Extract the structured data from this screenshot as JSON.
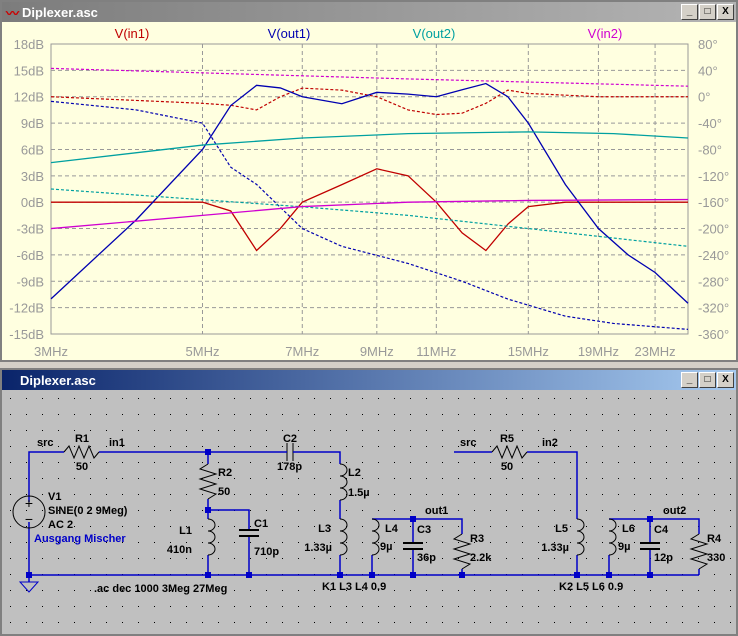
{
  "plot_window": {
    "title": "Diplexer.asc",
    "buttons": [
      "_",
      "□",
      "X"
    ]
  },
  "schematic_window": {
    "title": "Diplexer.asc",
    "buttons": [
      "_",
      "□",
      "X"
    ]
  },
  "chart_data": {
    "type": "line",
    "title": "",
    "xscale": "log",
    "xlim": [
      3,
      25.7
    ],
    "x_ticks": [
      "3MHz",
      "5MHz",
      "7MHz",
      "9MHz",
      "11MHz",
      "15MHz",
      "19MHz",
      "23MHz"
    ],
    "x_tick_values": [
      3,
      5,
      7,
      9,
      11,
      15,
      19,
      23
    ],
    "y_ticks": [
      "18dB",
      "15dB",
      "12dB",
      "9dB",
      "6dB",
      "3dB",
      "0dB",
      "-3dB",
      "-6dB",
      "-9dB",
      "-12dB",
      "-15dB"
    ],
    "ylim": [
      -15,
      18
    ],
    "y2_ticks": [
      "80°",
      "40°",
      "0°",
      "-40°",
      "-80°",
      "-120°",
      "-160°",
      "-200°",
      "-240°",
      "-280°",
      "-320°",
      "-360°"
    ],
    "y2lim": [
      -360,
      80
    ],
    "grid": true,
    "series": [
      {
        "name": "V(in1)",
        "color": "#c00000",
        "mag": [
          [
            3,
            0
          ],
          [
            5,
            0
          ],
          [
            5.5,
            -1
          ],
          [
            6,
            -5.5
          ],
          [
            6.5,
            -3
          ],
          [
            7,
            0
          ],
          [
            8,
            2
          ],
          [
            9,
            3.8
          ],
          [
            10,
            3
          ],
          [
            11,
            0
          ],
          [
            12,
            -3.5
          ],
          [
            13,
            -5.5
          ],
          [
            14,
            -2.5
          ],
          [
            15,
            -0.5
          ],
          [
            17,
            0
          ],
          [
            25.7,
            0
          ]
        ],
        "phase": [
          [
            3,
            0
          ],
          [
            5,
            -10
          ],
          [
            5.5,
            -13
          ],
          [
            6,
            -20
          ],
          [
            6.5,
            0
          ],
          [
            7,
            13
          ],
          [
            8,
            10
          ],
          [
            9,
            0
          ],
          [
            10,
            -20
          ],
          [
            11,
            -27
          ],
          [
            12,
            -25
          ],
          [
            13,
            -10
          ],
          [
            14,
            10
          ],
          [
            15,
            5
          ],
          [
            19,
            0
          ],
          [
            25.7,
            0
          ]
        ]
      },
      {
        "name": "V(out1)",
        "color": "#0000b0",
        "mag": [
          [
            3,
            -11
          ],
          [
            4,
            -2
          ],
          [
            5,
            6
          ],
          [
            5.5,
            11
          ],
          [
            6,
            13.3
          ],
          [
            6.5,
            13
          ],
          [
            7,
            12
          ],
          [
            8,
            11.2
          ],
          [
            9,
            12.5
          ],
          [
            10,
            12.3
          ],
          [
            11,
            12
          ],
          [
            12,
            12.8
          ],
          [
            13,
            13.5
          ],
          [
            14,
            12
          ],
          [
            15,
            9
          ],
          [
            17,
            2
          ],
          [
            19,
            -3
          ],
          [
            21,
            -6
          ],
          [
            23,
            -8
          ],
          [
            25.7,
            -11.5
          ]
        ],
        "phase": [
          [
            3,
            -7
          ],
          [
            4,
            -20
          ],
          [
            5,
            -40
          ],
          [
            5.5,
            -107
          ],
          [
            6,
            -133
          ],
          [
            7,
            -200
          ],
          [
            8,
            -227
          ],
          [
            10,
            -253
          ],
          [
            12,
            -280
          ],
          [
            14,
            -307
          ],
          [
            17,
            -333
          ],
          [
            20,
            -344
          ],
          [
            25.7,
            -353
          ]
        ]
      },
      {
        "name": "V(out2)",
        "color": "#00a0a0",
        "mag": [
          [
            3,
            4.5
          ],
          [
            5,
            6.5
          ],
          [
            7,
            7.3
          ],
          [
            10,
            7.8
          ],
          [
            15,
            8
          ],
          [
            20,
            7.8
          ],
          [
            25.7,
            7.3
          ]
        ],
        "phase": [
          [
            3,
            -140
          ],
          [
            7,
            -167
          ],
          [
            10,
            -180
          ],
          [
            15,
            -200
          ],
          [
            25.7,
            -227
          ]
        ]
      },
      {
        "name": "V(in2)",
        "color": "#d000d0",
        "mag": [
          [
            3,
            -3
          ],
          [
            5,
            -1.5
          ],
          [
            7,
            -0.5
          ],
          [
            10,
            0
          ],
          [
            15,
            0.2
          ],
          [
            25.7,
            0.3
          ]
        ],
        "phase": [
          [
            3,
            43
          ],
          [
            10,
            27
          ],
          [
            25.7,
            16
          ]
        ]
      }
    ]
  },
  "schematic": {
    "labels": {
      "src1": "src",
      "R1": "R1",
      "R1v": "50",
      "in1": "in1",
      "R2": "R2",
      "R2v": "50",
      "C2": "C2",
      "C2v": "178p",
      "L2": "L2",
      "L2v": "1.5µ",
      "V1": "V1",
      "V1a": "SINE(0 2 9Meg)",
      "V1b": "AC 2",
      "comment": "Ausgang Mischer",
      "L1": "L1",
      "L1v": "410n",
      "C1": "C1",
      "C1v": "710p",
      "L3": "L3",
      "L3v": "1.33µ",
      "L4": "L4",
      "L4v": "9µ",
      "out1": "out1",
      "C3": "C3",
      "C3v": "36p",
      "R3": "R3",
      "R3v": "2.2k",
      "src2": "src",
      "R5": "R5",
      "R5v": "50",
      "in2": "in2",
      "L5": "L5",
      "L5v": "1.33µ",
      "L6": "L6",
      "L6v": "9µ",
      "out2": "out2",
      "C4": "C4",
      "C4v": "12p",
      "R4": "R4",
      "R4v": "330",
      "ac": ".ac dec 1000 3Meg 27Meg",
      "K1": "K1 L3 L4 0.9",
      "K2": "K2 L5 L6 0.9"
    }
  }
}
